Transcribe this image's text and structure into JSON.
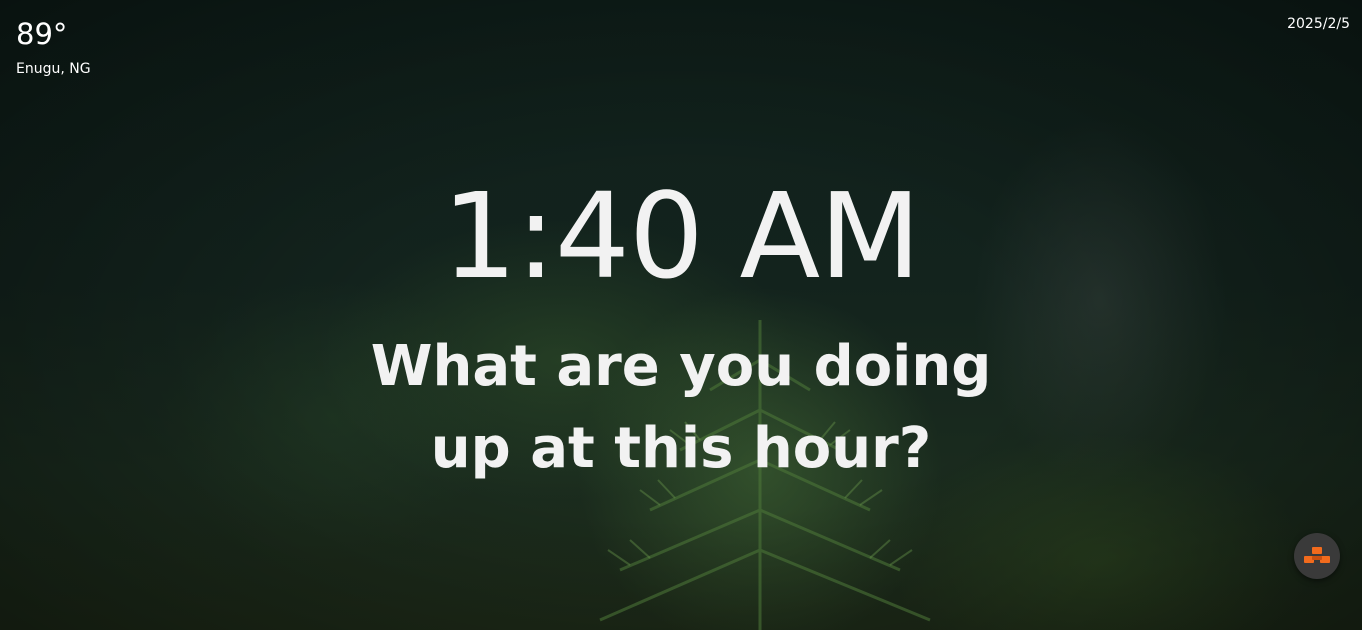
{
  "weather": {
    "temperature": "89°",
    "location": "Enugu, NG"
  },
  "date": "2025/2/5",
  "clock": {
    "time": "1:40 AM"
  },
  "greeting": "What are you doing up at this hour?",
  "extension_button": {
    "icon": "stacked-blocks-icon",
    "icon_color": "#f26b1d"
  },
  "colors": {
    "text": "#f2f2f2",
    "background": "#10211c",
    "accent": "#f26b1d"
  }
}
